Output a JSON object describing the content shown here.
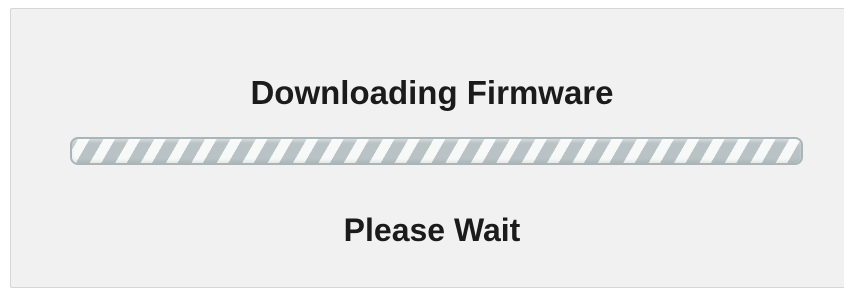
{
  "dialog": {
    "title": "Downloading Firmware",
    "subtitle": "Please Wait"
  },
  "progress": {
    "fraction": 1.0,
    "indeterminate": true
  },
  "colors": {
    "background": "#f1f1f1",
    "text": "#1b1b1b",
    "progress_border": "#a9b5b8"
  }
}
